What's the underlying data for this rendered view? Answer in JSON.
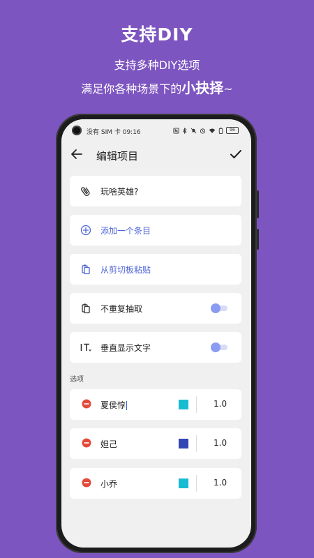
{
  "promo": {
    "title": "支持DIY",
    "line1": "支持多种DIY选项",
    "line2_prefix": "满足你各种场景下的",
    "line2_emphasis": "小抉择",
    "line2_suffix": "~"
  },
  "status_bar": {
    "left": "没有 SIM 卡 09:16",
    "icons": [
      "nfc-icon",
      "bluetooth-icon",
      "mute-icon",
      "alarm-icon",
      "wifi-icon",
      "battery-saver-icon"
    ],
    "battery": "96"
  },
  "appbar": {
    "title": "编辑项目",
    "back_icon": "arrow-left-icon",
    "confirm_icon": "check-icon"
  },
  "project": {
    "name": "玩啥英雄?",
    "icon": "paperclip-icon"
  },
  "actions": {
    "add_item": "添加一个条目",
    "paste_clipboard": "从剪切板粘贴",
    "accent_color": "#4e64d6"
  },
  "toggles": [
    {
      "label": "不重复抽取",
      "icon": "clipboard-icon",
      "enabled": true
    },
    {
      "label": "垂直显示文字",
      "icon": "vertical-text-icon",
      "enabled": true
    }
  ],
  "options_section": {
    "label": "选项",
    "items": [
      {
        "name": "夏侯惇",
        "color": "#17bcd2",
        "weight": "1.0",
        "editing": true
      },
      {
        "name": "妲己",
        "color": "#3346b3",
        "weight": "1.0",
        "editing": false
      },
      {
        "name": "小乔",
        "color": "#17bcd2",
        "weight": "1.0",
        "editing": false
      }
    ],
    "remove_icon_color": "#e24a3b"
  },
  "colors": {
    "background": "#7d55c0",
    "toggle_knob": "#8a9cf2"
  }
}
